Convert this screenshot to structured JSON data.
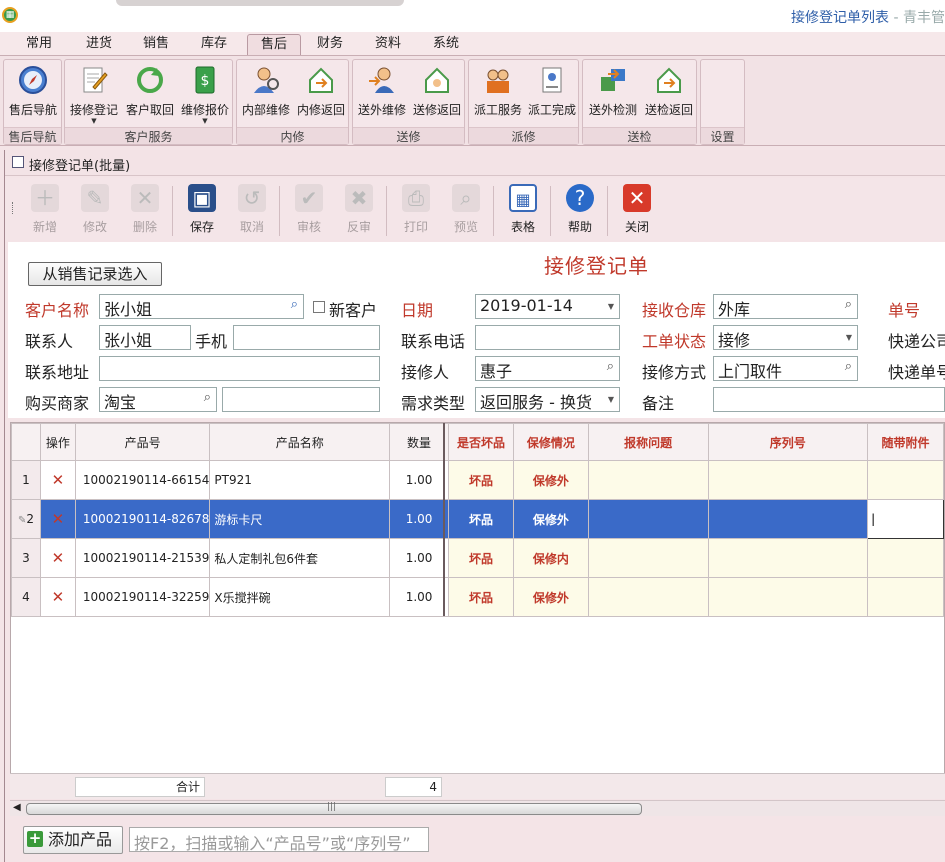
{
  "window": {
    "title": "接修登记单列表",
    "title_suffix": " - 青丰管"
  },
  "tabs": [
    "常用",
    "进货",
    "销售",
    "库存",
    "售后",
    "财务",
    "资料",
    "系统"
  ],
  "active_tab": 4,
  "ribbon_groups": [
    {
      "caption": "售后导航",
      "buttons": [
        "售后导航"
      ]
    },
    {
      "caption": "客户服务",
      "buttons": [
        "接修登记",
        "客户取回",
        "维修报价"
      ]
    },
    {
      "caption": "内修",
      "buttons": [
        "内部维修",
        "内修返回"
      ]
    },
    {
      "caption": "送修",
      "buttons": [
        "送外维修",
        "送修返回"
      ]
    },
    {
      "caption": "派修",
      "buttons": [
        "派工服务",
        "派工完成"
      ]
    },
    {
      "caption": "送检",
      "buttons": [
        "送外检测",
        "送检返回"
      ]
    },
    {
      "caption": "设置",
      "buttons": []
    }
  ],
  "doc_title": "接修登记单(批量)",
  "toolbar": [
    {
      "label": "新增",
      "enabled": false
    },
    {
      "label": "修改",
      "enabled": false
    },
    {
      "label": "删除",
      "enabled": false
    },
    {
      "label": "保存",
      "enabled": true
    },
    {
      "label": "取消",
      "enabled": false
    },
    {
      "label": "审核",
      "enabled": false
    },
    {
      "label": "反审",
      "enabled": false
    },
    {
      "label": "打印",
      "enabled": false
    },
    {
      "label": "预览",
      "enabled": false
    },
    {
      "label": "表格",
      "enabled": true
    },
    {
      "label": "帮助",
      "enabled": true
    },
    {
      "label": "关闭",
      "enabled": true
    }
  ],
  "form": {
    "import_button": "从销售记录选入",
    "title": "接修登记单",
    "labels": {
      "customer": "客户名称",
      "new_customer": "新客户",
      "date": "日期",
      "warehouse": "接收仓库",
      "doc_no": "单号",
      "contact": "联系人",
      "mobile": "手机",
      "phone": "联系电话",
      "status": "工单状态",
      "courier": "快递公司",
      "address": "联系地址",
      "receiver": "接修人",
      "method": "接修方式",
      "tracking": "快递单号",
      "merchant": "购买商家",
      "demand": "需求类型",
      "remark": "备注"
    },
    "values": {
      "customer": "张小姐",
      "date": "2019-01-14",
      "warehouse": "外库",
      "contact": "张小姐",
      "mobile": "",
      "phone": "",
      "status": "接修",
      "address": "",
      "receiver": "惠子",
      "method": "上门取件",
      "merchant": "淘宝",
      "merchant_extra": "",
      "demand": "返回服务 - 换货",
      "remark": ""
    }
  },
  "grid": {
    "columns": [
      "",
      "操作",
      "产品号",
      "产品名称",
      "数量",
      "是否坏品",
      "保修情况",
      "报称问题",
      "序列号",
      "随带附件"
    ],
    "rows": [
      {
        "n": "1",
        "code": "10002190114-66154",
        "name": "PT921",
        "qty": "1.00",
        "bad": "坏品",
        "warranty": "保修外",
        "issue": "",
        "serial": "",
        "accessory": ""
      },
      {
        "n": "2",
        "code": "10002190114-82678",
        "name": "游标卡尺",
        "qty": "1.00",
        "bad": "坏品",
        "warranty": "保修外",
        "issue": "",
        "serial": "",
        "accessory": ""
      },
      {
        "n": "3",
        "code": "10002190114-21539",
        "name": "私人定制礼包6件套",
        "qty": "1.00",
        "bad": "坏品",
        "warranty": "保修内",
        "issue": "",
        "serial": "",
        "accessory": ""
      },
      {
        "n": "4",
        "code": "10002190114-32259",
        "name": "X乐搅拌碗",
        "qty": "1.00",
        "bad": "坏品",
        "warranty": "保修外",
        "issue": "",
        "serial": "",
        "accessory": ""
      }
    ],
    "selected_row": 2,
    "summary_label": "合计",
    "summary_qty": "4"
  },
  "bottom": {
    "add_button": "添加产品",
    "scan_placeholder": "按F2，扫描或输入“产品号”或“序列号”"
  },
  "colors": {
    "accent_red": "#c0392b",
    "selection_blue": "#3a6ac8",
    "title_blue": "#2e5ea8"
  }
}
